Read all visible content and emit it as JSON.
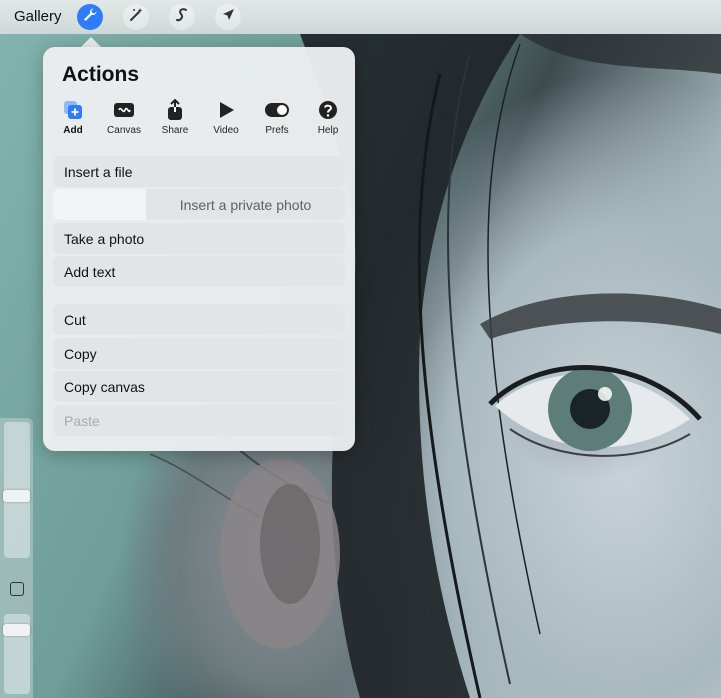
{
  "topbar": {
    "gallery_label": "Gallery",
    "tools": [
      {
        "name": "actions",
        "icon": "wrench-icon",
        "active": true
      },
      {
        "name": "adjustments",
        "icon": "magic-wand-icon",
        "active": false
      },
      {
        "name": "selection",
        "icon": "selection-s-icon",
        "active": false
      },
      {
        "name": "transform",
        "icon": "arrow-cursor-icon",
        "active": false
      }
    ]
  },
  "actions": {
    "title": "Actions",
    "tabs": [
      {
        "label": "Add",
        "icon": "add-icon",
        "active": true
      },
      {
        "label": "Canvas",
        "icon": "canvas-icon",
        "active": false
      },
      {
        "label": "Share",
        "icon": "share-icon",
        "active": false
      },
      {
        "label": "Video",
        "icon": "play-icon",
        "active": false
      },
      {
        "label": "Prefs",
        "icon": "toggle-icon",
        "active": false
      },
      {
        "label": "Help",
        "icon": "help-icon",
        "active": false
      }
    ],
    "items": {
      "insert_file": "Insert a file",
      "insert_private_photo": "Insert a private photo",
      "take_photo": "Take a photo",
      "add_text": "Add text",
      "cut": "Cut",
      "copy": "Copy",
      "copy_canvas": "Copy canvas",
      "paste": "Paste"
    }
  },
  "colors": {
    "accent": "#2f7df6",
    "popover_bg": "#eceeef"
  }
}
